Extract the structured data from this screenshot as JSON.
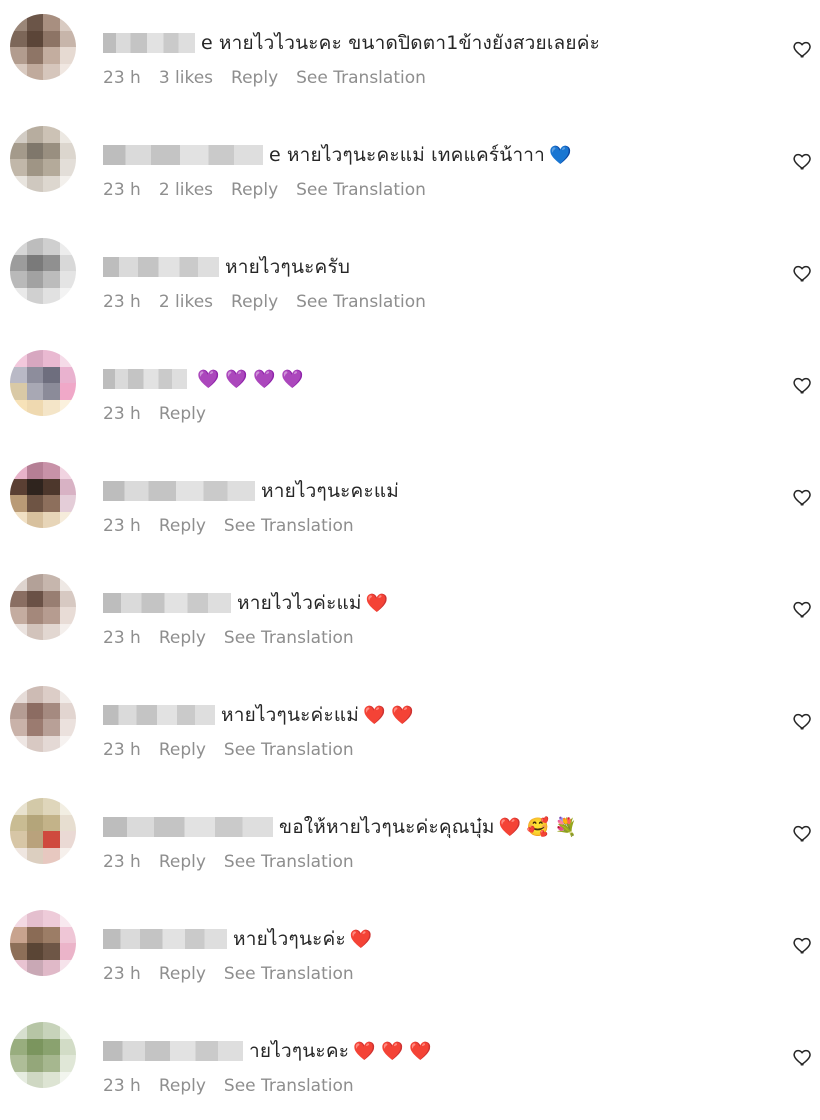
{
  "comments": [
    {
      "time": "23 h",
      "likes": "3 likes",
      "reply": "Reply",
      "translate": "See Translation",
      "name_tail": "e",
      "text": "หายไวไวนะคะ ขนาดปิดตา1ข้างยังสวยเลยค่ะ",
      "emoji": "",
      "colors": [
        "#9a8678",
        "#6b5548",
        "#a88f80",
        "#d9cbc2",
        "#7c6658",
        "#5b4538",
        "#8d7465",
        "#c7b5aa",
        "#b29c8e",
        "#8e7566",
        "#c3ad9f",
        "#e6dad2",
        "#d8c9bf",
        "#c0aa9c",
        "#d6c6bc",
        "#f0e7e1"
      ]
    },
    {
      "time": "23 h",
      "likes": "2 likes",
      "reply": "Reply",
      "translate": "See Translation",
      "name_tail": "e",
      "text": "หายไวๆนะคะแม่ เทคแคร์น้าาา",
      "emoji": "💙",
      "colors": [
        "#d2ccc4",
        "#b7ad9f",
        "#ccc2b5",
        "#ece8e2",
        "#a49a8b",
        "#7f776b",
        "#998f80",
        "#dcd6ce",
        "#c1b7a9",
        "#9f9585",
        "#b4aa9a",
        "#e3ded8",
        "#e8e4de",
        "#cfc8bf",
        "#ddd7cf",
        "#f3f0ec"
      ]
    },
    {
      "time": "23 h",
      "likes": "2 likes",
      "reply": "Reply",
      "translate": "See Translation",
      "name_tail": "",
      "text": "หายไวๆนะครับ",
      "emoji": "",
      "colors": [
        "#d6d6d6",
        "#bdbdbd",
        "#cfcfcf",
        "#ececec",
        "#9c9c9c",
        "#7a7a7a",
        "#909090",
        "#d8d8d8",
        "#b9b9b9",
        "#a2a2a2",
        "#bcbcbc",
        "#e4e4e4",
        "#e9e9e9",
        "#d0d0d0",
        "#e1e1e1",
        "#f3f3f3"
      ]
    },
    {
      "time": "23 h",
      "likes": "",
      "reply": "Reply",
      "translate": "",
      "name_tail": "",
      "text": "",
      "emoji": "💜 💜 💜 💜",
      "colors": [
        "#f2c8dc",
        "#d7a7c0",
        "#e9b9d1",
        "#f5dbe8",
        "#b9b9c6",
        "#8d8d9c",
        "#6e6e7e",
        "#e9b2cf",
        "#d9c9a6",
        "#a8a8b4",
        "#8b8b99",
        "#f0a8c8",
        "#f7e2b8",
        "#efd9b0",
        "#f4e5c8",
        "#fbf1dd"
      ]
    },
    {
      "time": "23 h",
      "likes": "",
      "reply": "Reply",
      "translate": "See Translation",
      "name_tail": "",
      "text": "หายไวๆนะคะแม่",
      "emoji": "",
      "colors": [
        "#e7b3c9",
        "#b57f95",
        "#c892a8",
        "#f1d4e1",
        "#5a3f33",
        "#2f241e",
        "#4d372c",
        "#d8b2c4",
        "#b99a76",
        "#6e5444",
        "#8d6f5c",
        "#e4cdd8",
        "#f1e0c4",
        "#d8c19e",
        "#e7d5b8",
        "#f6ecdb"
      ]
    },
    {
      "time": "23 h",
      "likes": "",
      "reply": "Reply",
      "translate": "See Translation",
      "name_tail": "",
      "text": "หายไวไวค่ะแม่",
      "emoji": "❤️",
      "colors": [
        "#ded4cf",
        "#b3a198",
        "#c6b6ad",
        "#eee8e4",
        "#8a6e62",
        "#6a5146",
        "#987e72",
        "#d7c9c2",
        "#c4aca0",
        "#a4887b",
        "#b69c90",
        "#e8dcd6",
        "#eae2de",
        "#d2c3bb",
        "#e2d7d1",
        "#f4efec"
      ]
    },
    {
      "time": "23 h",
      "likes": "",
      "reply": "Reply",
      "translate": "See Translation",
      "name_tail": "",
      "text": "หายไวๆนะค่ะแม่",
      "emoji": "❤️ ❤️",
      "colors": [
        "#e6dcd8",
        "#cdbbb4",
        "#dccdc7",
        "#f1ebe8",
        "#b59d94",
        "#8c6c62",
        "#a58a80",
        "#e2d5d0",
        "#c9b2a9",
        "#9b7b70",
        "#b8a097",
        "#ebe1dd",
        "#eee6e3",
        "#d8c9c3",
        "#e4d9d5",
        "#f6f2f0"
      ]
    },
    {
      "time": "23 h",
      "likes": "",
      "reply": "Reply",
      "translate": "See Translation",
      "name_tail": "",
      "text": "ขอให้หายไวๆนะค่ะคุณบุ๋ม",
      "emoji": "❤️ 🥰 💐",
      "colors": [
        "#e8e2cf",
        "#d3c9a8",
        "#dfd6bb",
        "#f2eee2",
        "#c9bc93",
        "#b4a57a",
        "#c3b389",
        "#e7ded0",
        "#d7c6a6",
        "#b9a27c",
        "#cf4a3e",
        "#ead9d4",
        "#efe6e0",
        "#dccfc0",
        "#e7c8c0",
        "#f6f0ec"
      ]
    },
    {
      "time": "23 h",
      "likes": "",
      "reply": "Reply",
      "translate": "See Translation",
      "name_tail": "",
      "text": "หายไวๆนะค่ะ",
      "emoji": "❤️",
      "colors": [
        "#f3d9e3",
        "#e4bfce",
        "#eecbd9",
        "#f8e9ef",
        "#c8a38e",
        "#8a6b55",
        "#9c7d66",
        "#efc6d6",
        "#8d6f58",
        "#5a4535",
        "#6e5646",
        "#ebb4c9",
        "#e9c4d2",
        "#c9a8b5",
        "#e0b9c8",
        "#f6e3eb"
      ]
    },
    {
      "time": "23 h",
      "likes": "",
      "reply": "Reply",
      "translate": "See Translation",
      "name_tail": "",
      "text": "ายไวๆนะคะ",
      "emoji": "❤️ ❤️ ❤️",
      "colors": [
        "#d7dfcf",
        "#b6c5a5",
        "#c7d3ba",
        "#eaf0e4",
        "#98ad7e",
        "#7b955e",
        "#8aa26f",
        "#d2dcc6",
        "#aebd98",
        "#94a77a",
        "#a6b78f",
        "#e0e7d7",
        "#e6ece0",
        "#cfd8c3",
        "#dde4d3",
        "#f2f5ee"
      ]
    }
  ]
}
